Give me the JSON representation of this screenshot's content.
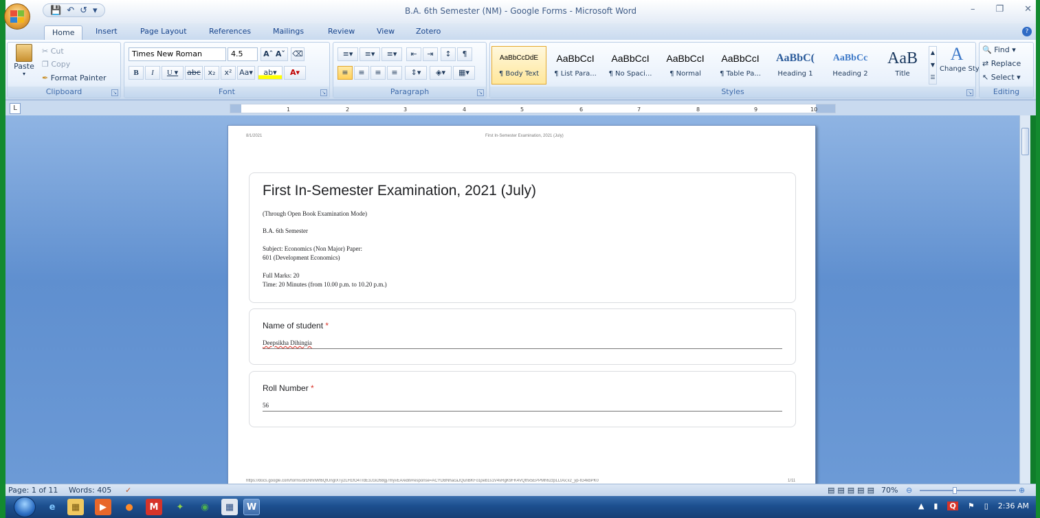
{
  "window": {
    "title": "B.A. 6th Semester (NM) - Google Forms - Microsoft Word"
  },
  "tabs": [
    "Home",
    "Insert",
    "Page Layout",
    "References",
    "Mailings",
    "Review",
    "View",
    "Zotero"
  ],
  "clipboard": {
    "paste": "Paste",
    "cut": "Cut",
    "copy": "Copy",
    "format_painter": "Format Painter",
    "label": "Clipboard"
  },
  "font": {
    "name": "Times New Roman",
    "size": "4.5",
    "label": "Font"
  },
  "paragraph": {
    "label": "Paragraph"
  },
  "styles": {
    "label": "Styles",
    "items": [
      {
        "preview": "AaBbCcDdE",
        "name": "¶ Body Text"
      },
      {
        "preview": "AaBbCcI",
        "name": "¶ List Para..."
      },
      {
        "preview": "AaBbCcI",
        "name": "¶ No Spaci..."
      },
      {
        "preview": "AaBbCcI",
        "name": "¶ Normal"
      },
      {
        "preview": "AaBbCcI",
        "name": "¶ Table Pa..."
      },
      {
        "preview": "AaBbC(",
        "name": "Heading 1"
      },
      {
        "preview": "AaBbCc",
        "name": "Heading 2"
      },
      {
        "preview": "AaB",
        "name": "Title"
      }
    ],
    "change": "Change Styles"
  },
  "editing": {
    "find": "Find",
    "replace": "Replace",
    "select": "Select",
    "label": "Editing"
  },
  "page": {
    "header_date": "8/1/2021",
    "header_title": "First In-Semester Examination, 2021 (July)",
    "form_title": "First In-Semester Examination, 2021 (July)",
    "line1": "(Through Open Book Examination Mode)",
    "line2": "B.A. 6th Semester",
    "line3": "Subject: Economics (Non Major) Paper:",
    "line4": "601 (Development Economics)",
    "line5": "Full Marks: 20",
    "line6": "Time: 20 Minutes (from 10.00 p.m. to 10.20 p.m.)",
    "q1_label": "Name of student",
    "q1_answer": "Deepsikha Dihingia",
    "q2_label": "Roll Number",
    "q2_answer": "56",
    "footer_url": "https://docs.google.com/forms/d/1NhnWt6QtUngIXTy2LH1fO4TrdE3J1k268gj7myvEA/edit#response=ACYDBNhacaJQunBKFo1peb1s1V4vRgK9FK4VQthx5EPPMh62zpLLtAx;x2_yp-tG4kbPK0",
    "footer_page": "1/11",
    "required_mark": "*"
  },
  "status": {
    "page": "Page: 1 of 11",
    "words": "Words: 405",
    "zoom": "70%"
  },
  "taskbar": {
    "time": "2:36 AM"
  }
}
